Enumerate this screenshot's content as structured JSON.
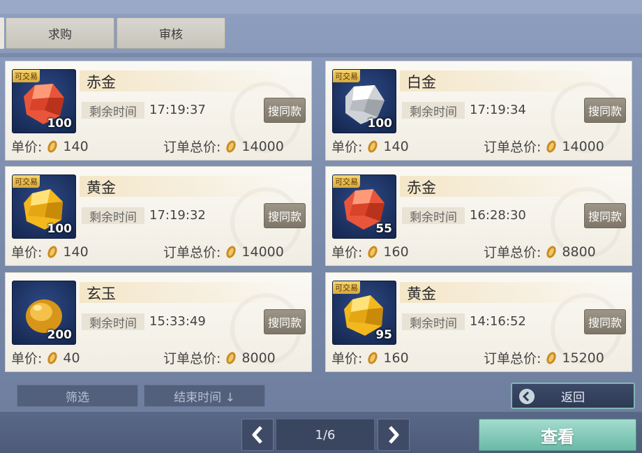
{
  "tabs": [
    {
      "label": "求购"
    },
    {
      "label": "审核"
    }
  ],
  "labels": {
    "trade_tag": "可交易",
    "time_label": "剩余时间",
    "search_same": "搜同款",
    "unit_price": "单价:",
    "order_total": "订单总价:"
  },
  "items": [
    {
      "name": "赤金",
      "qty": "100",
      "time": "17:19:37",
      "unit_price": "140",
      "total": "14000",
      "tradable": true,
      "gem": "red-gem-icon"
    },
    {
      "name": "白金",
      "qty": "100",
      "time": "17:19:34",
      "unit_price": "140",
      "total": "14000",
      "tradable": true,
      "gem": "silver-gem-icon"
    },
    {
      "name": "黄金",
      "qty": "100",
      "time": "17:19:32",
      "unit_price": "140",
      "total": "14000",
      "tradable": true,
      "gem": "gold-gem-icon"
    },
    {
      "name": "赤金",
      "qty": "55",
      "time": "16:28:30",
      "unit_price": "160",
      "total": "8800",
      "tradable": true,
      "gem": "red-gem-icon"
    },
    {
      "name": "玄玉",
      "qty": "200",
      "time": "15:33:49",
      "unit_price": "40",
      "total": "8000",
      "tradable": false,
      "gem": "amber-jade-icon"
    },
    {
      "name": "黄金",
      "qty": "95",
      "time": "14:16:52",
      "unit_price": "160",
      "total": "15200",
      "tradable": true,
      "gem": "gold-gem-icon"
    }
  ],
  "filters": {
    "filter_label": "筛选",
    "sort_label": "结束时间 ↓"
  },
  "actions": {
    "return_label": "返回",
    "view_label": "查看"
  },
  "pagination": {
    "indicator": "1/6"
  },
  "colors": {
    "accent_teal": "#7fb8b1",
    "view_button": "#8fcfbe",
    "trade_tag": "#e8c35a"
  }
}
